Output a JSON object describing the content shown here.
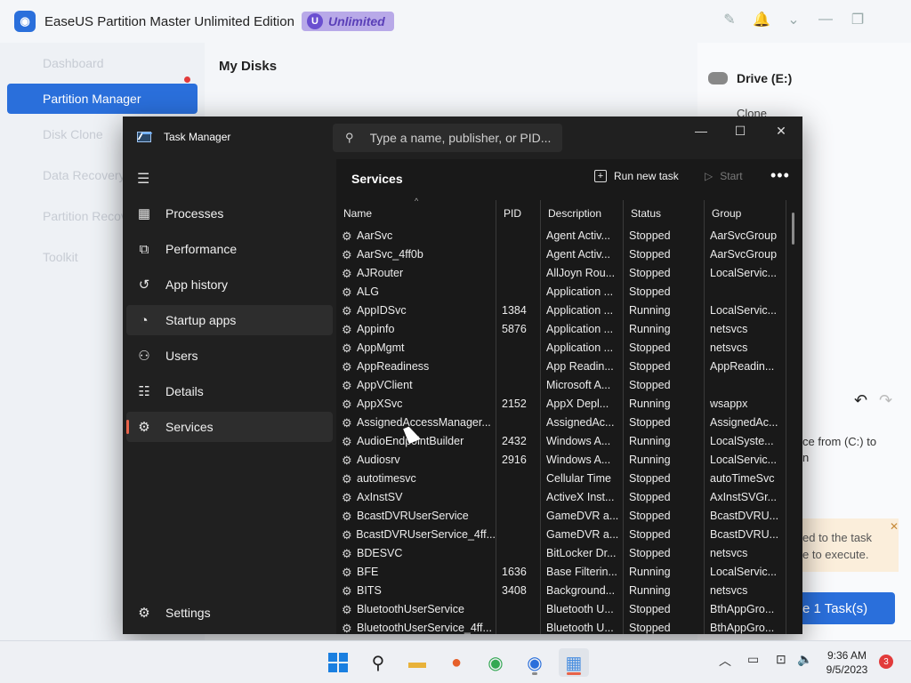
{
  "background_app": {
    "title": "EaseUS Partition Master Unlimited Edition",
    "badge": "Unlimited",
    "sidebar_items": [
      "Dashboard",
      "Partition Manager",
      "Disk Clone",
      "Data Recovery",
      "Partition Recovery",
      "Toolkit"
    ],
    "sidebar_active": "Partition Manager",
    "main_title": "My Disks",
    "drive_label": "Drive (E:)",
    "clone_label": "Clone",
    "desc_text": "ce from (C:) to\nn",
    "note_text": "ed to the task\ne to execute.",
    "task_button": "e 1 Task(s)"
  },
  "task_manager": {
    "app_title": "Task Manager",
    "search_placeholder": "Type a name, publisher, or PID...",
    "nav": [
      {
        "label": "Processes",
        "icon": "processes-icon"
      },
      {
        "label": "Performance",
        "icon": "performance-icon"
      },
      {
        "label": "App history",
        "icon": "app-history-icon"
      },
      {
        "label": "Startup apps",
        "icon": "startup-apps-icon"
      },
      {
        "label": "Users",
        "icon": "users-icon"
      },
      {
        "label": "Details",
        "icon": "details-icon"
      },
      {
        "label": "Services",
        "icon": "services-icon"
      }
    ],
    "selected_nav": "Services",
    "hovered_nav": "Startup apps",
    "settings_label": "Settings",
    "page_title": "Services",
    "run_new_task": "Run new task",
    "start": "Start",
    "columns": [
      "Name",
      "PID",
      "Description",
      "Status",
      "Group"
    ],
    "rows": [
      [
        "AarSvc",
        "",
        "Agent Activ...",
        "Stopped",
        "AarSvcGroup"
      ],
      [
        "AarSvc_4ff0b",
        "",
        "Agent Activ...",
        "Stopped",
        "AarSvcGroup"
      ],
      [
        "AJRouter",
        "",
        "AllJoyn Rou...",
        "Stopped",
        "LocalServic..."
      ],
      [
        "ALG",
        "",
        "Application ...",
        "Stopped",
        ""
      ],
      [
        "AppIDSvc",
        "1384",
        "Application ...",
        "Running",
        "LocalServic..."
      ],
      [
        "Appinfo",
        "5876",
        "Application ...",
        "Running",
        "netsvcs"
      ],
      [
        "AppMgmt",
        "",
        "Application ...",
        "Stopped",
        "netsvcs"
      ],
      [
        "AppReadiness",
        "",
        "App Readin...",
        "Stopped",
        "AppReadin..."
      ],
      [
        "AppVClient",
        "",
        "Microsoft A...",
        "Stopped",
        ""
      ],
      [
        "AppXSvc",
        "2152",
        "AppX Depl...",
        "Running",
        "wsappx"
      ],
      [
        "AssignedAccessManager...",
        "",
        "AssignedAc...",
        "Stopped",
        "AssignedAc..."
      ],
      [
        "AudioEndpointBuilder",
        "2432",
        "Windows A...",
        "Running",
        "LocalSyste..."
      ],
      [
        "Audiosrv",
        "2916",
        "Windows A...",
        "Running",
        "LocalServic..."
      ],
      [
        "autotimesvc",
        "",
        "Cellular Time",
        "Stopped",
        "autoTimeSvc"
      ],
      [
        "AxInstSV",
        "",
        "ActiveX Inst...",
        "Stopped",
        "AxInstSVGr..."
      ],
      [
        "BcastDVRUserService",
        "",
        "GameDVR a...",
        "Stopped",
        "BcastDVRU..."
      ],
      [
        "BcastDVRUserService_4ff...",
        "",
        "GameDVR a...",
        "Stopped",
        "BcastDVRU..."
      ],
      [
        "BDESVC",
        "",
        "BitLocker Dr...",
        "Stopped",
        "netsvcs"
      ],
      [
        "BFE",
        "1636",
        "Base Filterin...",
        "Running",
        "LocalServic..."
      ],
      [
        "BITS",
        "3408",
        "Background...",
        "Running",
        "netsvcs"
      ],
      [
        "BluetoothUserService",
        "",
        "Bluetooth U...",
        "Stopped",
        "BthAppGro..."
      ],
      [
        "BluetoothUserService_4ff...",
        "",
        "Bluetooth U...",
        "Stopped",
        "BthAppGro..."
      ]
    ]
  },
  "taskbar": {
    "time": "9:36 AM",
    "date": "9/5/2023",
    "notification_count": "3"
  }
}
